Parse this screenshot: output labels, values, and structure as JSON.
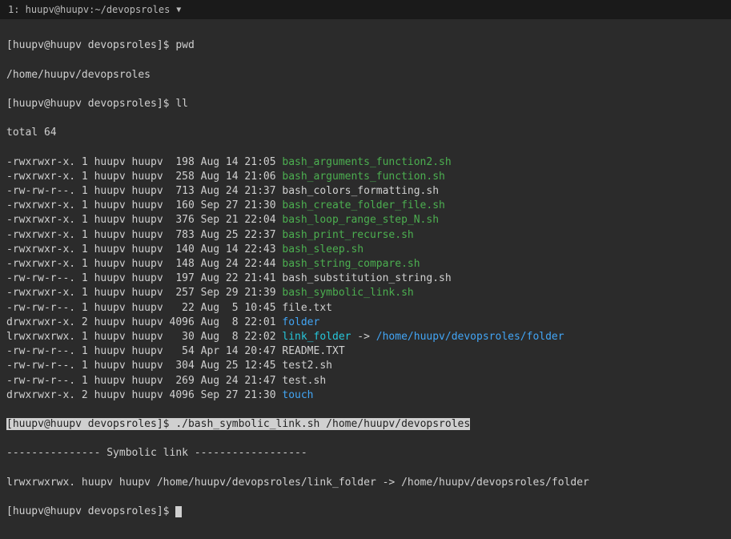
{
  "titlebar": {
    "text": "1: huupv@huupv:~/devopsroles",
    "dropdown": "▼"
  },
  "prompt1": {
    "user_host": "[huupv@huupv devopsroles]$ ",
    "cmd": "pwd"
  },
  "pwd_output": "/home/huupv/devopsroles",
  "prompt2": {
    "user_host": "[huupv@huupv devopsroles]$ ",
    "cmd": "ll"
  },
  "total_line": "total 64",
  "files": [
    {
      "perm": "-rwxrwxr-x.",
      "links": "1",
      "owner": "huupv",
      "group": "huupv",
      "size": " 198",
      "date": "Aug 14 21:05",
      "name": "bash_arguments_function2.sh",
      "type": "exec"
    },
    {
      "perm": "-rwxrwxr-x.",
      "links": "1",
      "owner": "huupv",
      "group": "huupv",
      "size": " 258",
      "date": "Aug 14 21:06",
      "name": "bash_arguments_function.sh",
      "type": "exec"
    },
    {
      "perm": "-rw-rw-r--.",
      "links": "1",
      "owner": "huupv",
      "group": "huupv",
      "size": " 713",
      "date": "Aug 24 21:37",
      "name": "bash_colors_formatting.sh",
      "type": "file"
    },
    {
      "perm": "-rwxrwxr-x.",
      "links": "1",
      "owner": "huupv",
      "group": "huupv",
      "size": " 160",
      "date": "Sep 27 21:30",
      "name": "bash_create_folder_file.sh",
      "type": "exec"
    },
    {
      "perm": "-rwxrwxr-x.",
      "links": "1",
      "owner": "huupv",
      "group": "huupv",
      "size": " 376",
      "date": "Sep 21 22:04",
      "name": "bash_loop_range_step_N.sh",
      "type": "exec"
    },
    {
      "perm": "-rwxrwxr-x.",
      "links": "1",
      "owner": "huupv",
      "group": "huupv",
      "size": " 783",
      "date": "Aug 25 22:37",
      "name": "bash_print_recurse.sh",
      "type": "exec"
    },
    {
      "perm": "-rwxrwxr-x.",
      "links": "1",
      "owner": "huupv",
      "group": "huupv",
      "size": " 140",
      "date": "Aug 14 22:43",
      "name": "bash_sleep.sh",
      "type": "exec"
    },
    {
      "perm": "-rwxrwxr-x.",
      "links": "1",
      "owner": "huupv",
      "group": "huupv",
      "size": " 148",
      "date": "Aug 24 22:44",
      "name": "bash_string_compare.sh",
      "type": "exec"
    },
    {
      "perm": "-rw-rw-r--.",
      "links": "1",
      "owner": "huupv",
      "group": "huupv",
      "size": " 197",
      "date": "Aug 22 21:41",
      "name": "bash_substitution_string.sh",
      "type": "file"
    },
    {
      "perm": "-rwxrwxr-x.",
      "links": "1",
      "owner": "huupv",
      "group": "huupv",
      "size": " 257",
      "date": "Sep 29 21:39",
      "name": "bash_symbolic_link.sh",
      "type": "exec"
    },
    {
      "perm": "-rw-rw-r--.",
      "links": "1",
      "owner": "huupv",
      "group": "huupv",
      "size": "  22",
      "date": "Aug  5 10:45",
      "name": "file.txt",
      "type": "file"
    },
    {
      "perm": "drwxrwxr-x.",
      "links": "2",
      "owner": "huupv",
      "group": "huupv",
      "size": "4096",
      "date": "Aug  8 22:01",
      "name": "folder",
      "type": "dir"
    },
    {
      "perm": "lrwxrwxrwx.",
      "links": "1",
      "owner": "huupv",
      "group": "huupv",
      "size": "  30",
      "date": "Aug  8 22:02",
      "name": "link_folder",
      "type": "link",
      "arrow": " -> ",
      "target": "/home/huupv/devopsroles/folder"
    },
    {
      "perm": "-rw-rw-r--.",
      "links": "1",
      "owner": "huupv",
      "group": "huupv",
      "size": "  54",
      "date": "Apr 14 20:47",
      "name": "README.TXT",
      "type": "file"
    },
    {
      "perm": "-rw-rw-r--.",
      "links": "1",
      "owner": "huupv",
      "group": "huupv",
      "size": " 304",
      "date": "Aug 25 12:45",
      "name": "test2.sh",
      "type": "file"
    },
    {
      "perm": "-rw-rw-r--.",
      "links": "1",
      "owner": "huupv",
      "group": "huupv",
      "size": " 269",
      "date": "Aug 24 21:47",
      "name": "test.sh",
      "type": "file"
    },
    {
      "perm": "drwxrwxr-x.",
      "links": "2",
      "owner": "huupv",
      "group": "huupv",
      "size": "4096",
      "date": "Sep 27 21:30",
      "name": "touch",
      "type": "dir"
    }
  ],
  "prompt3": {
    "user_host": "[huupv@huupv devopsroles]$ ",
    "cmd": "./bash_symbolic_link.sh /home/huupv/devopsroles"
  },
  "symbolic_header": "--------------- Symbolic link ------------------",
  "symbolic_output": "lrwxrwxrwx. huupv huupv /home/huupv/devopsroles/link_folder -> /home/huupv/devopsroles/folder",
  "prompt4": {
    "user_host": "[huupv@huupv devopsroles]$ "
  }
}
